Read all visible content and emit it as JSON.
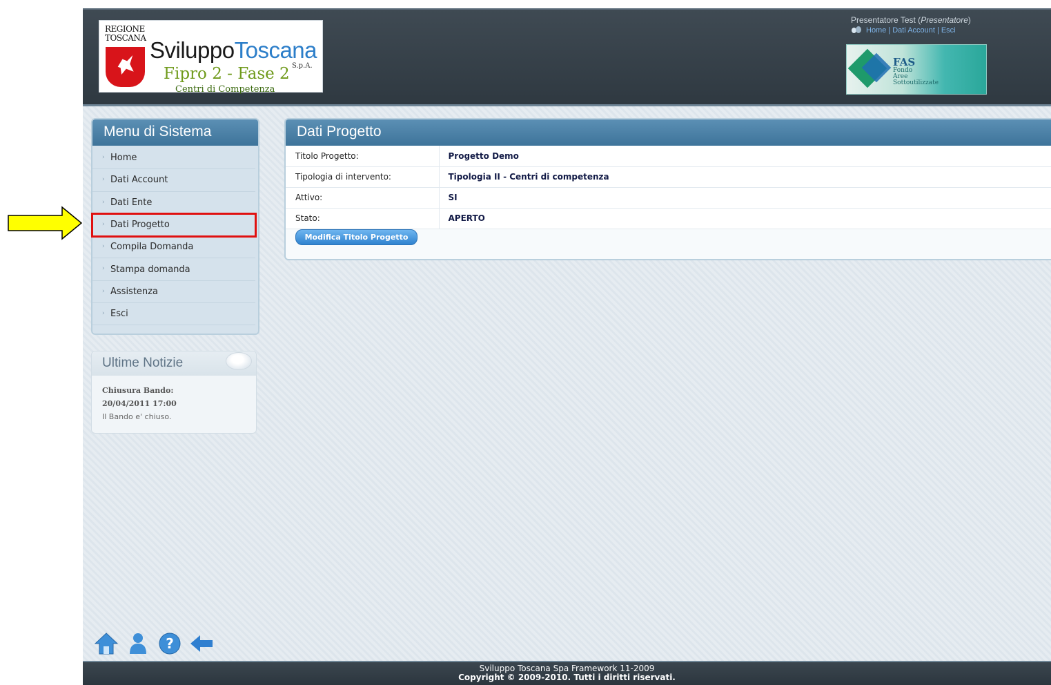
{
  "header": {
    "logo": {
      "region": "REGIONE TOSCANA",
      "brand_part1": "Sviluppo",
      "brand_part2": "Toscana",
      "spa": "S.p.A.",
      "project": "Fipro 2 - Fase 2",
      "subtitle": "Centri di Competenza"
    },
    "user": {
      "name": "Presentatore Test",
      "role": "Presentatore",
      "links": [
        "Home",
        "Dati Account",
        "Esci"
      ]
    },
    "fas_banner": {
      "title": "FAS",
      "subtitle_lines": [
        "Fondo",
        "Aree",
        "Sottoutilizzate"
      ]
    }
  },
  "menu": {
    "title": "Menu di Sistema",
    "items": [
      {
        "label": "Home"
      },
      {
        "label": "Dati Account"
      },
      {
        "label": "Dati Ente"
      },
      {
        "label": "Dati Progetto",
        "highlighted": true
      },
      {
        "label": "Compila Domanda"
      },
      {
        "label": "Stampa domanda"
      },
      {
        "label": "Assistenza"
      },
      {
        "label": "Esci"
      }
    ]
  },
  "news": {
    "title": "Ultime Notizie",
    "heading": "Chiusura Bando:",
    "date": "20/04/2011 17:00",
    "text": "Il Bando e' chiuso."
  },
  "main": {
    "title": "Dati Progetto",
    "rows": [
      {
        "label": "Titolo Progetto:",
        "value": "Progetto Demo"
      },
      {
        "label": "Tipologia di intervento:",
        "value": "Tipologia II - Centri di competenza"
      },
      {
        "label": "Attivo:",
        "value": "SI"
      },
      {
        "label": "Stato:",
        "value": "APERTO"
      }
    ],
    "button_label": "Modifica Titolo Progetto"
  },
  "bottom_icons": [
    "home-icon",
    "user-icon",
    "help-icon",
    "back-arrow-icon"
  ],
  "footer": {
    "line1": "Sviluppo Toscana Spa Framework 11-2009",
    "line2": "Copyright © 2009-2010. Tutti i diritti riservati."
  },
  "colors": {
    "header_bg": "#2f3941",
    "panel_head": "#4a80a8",
    "highlight": "#e01010",
    "annotation_arrow": "#f5f500"
  }
}
